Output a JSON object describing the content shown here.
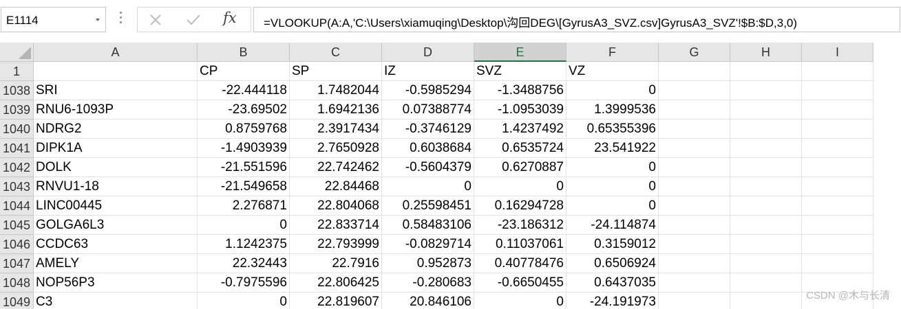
{
  "name_box": {
    "value": "E1114"
  },
  "formula_bar": {
    "fx_label": "fx",
    "formula": "=VLOOKUP(A:A,'C:\\Users\\xiamuqing\\Desktop\\沟回DEG\\[GyrusA3_SVZ.csv]GyrusA3_SVZ'!$B:$D,3,0)"
  },
  "columns": [
    "A",
    "B",
    "C",
    "D",
    "E",
    "F",
    "G",
    "H",
    "I"
  ],
  "selected_column": "E",
  "rows": [
    {
      "num": "1",
      "cells": [
        "",
        "CP",
        "SP",
        "IZ",
        "SVZ",
        "VZ"
      ]
    },
    {
      "num": "1038",
      "cells": [
        "SRI",
        "-22.444118",
        "1.7482044",
        "-0.5985294",
        "-1.3488756",
        "0"
      ]
    },
    {
      "num": "1039",
      "cells": [
        "RNU6-1093P",
        "-23.69502",
        "1.6942136",
        "0.07388774",
        "-1.0953039",
        "1.3999536"
      ]
    },
    {
      "num": "1040",
      "cells": [
        "NDRG2",
        "0.8759768",
        "2.3917434",
        "-0.3746129",
        "1.4237492",
        "0.65355396"
      ]
    },
    {
      "num": "1041",
      "cells": [
        "DIPK1A",
        "-1.4903939",
        "2.7650928",
        "0.6038684",
        "0.6535724",
        "23.541922"
      ]
    },
    {
      "num": "1042",
      "cells": [
        "DOLK",
        "-21.551596",
        "22.742462",
        "-0.5604379",
        "0.6270887",
        "0"
      ]
    },
    {
      "num": "1043",
      "cells": [
        "RNVU1-18",
        "-21.549658",
        "22.84468",
        "0",
        "0",
        "0"
      ]
    },
    {
      "num": "1044",
      "cells": [
        "LINC00445",
        "2.276871",
        "22.804068",
        "0.25598451",
        "0.16294728",
        "0"
      ]
    },
    {
      "num": "1045",
      "cells": [
        "GOLGA6L3",
        "0",
        "22.833714",
        "0.58483106",
        "-23.186312",
        "-24.114874"
      ]
    },
    {
      "num": "1046",
      "cells": [
        "CCDC63",
        "1.1242375",
        "22.793999",
        "-0.0829714",
        "0.11037061",
        "0.3159012"
      ]
    },
    {
      "num": "1047",
      "cells": [
        "AMELY",
        "22.32443",
        "22.7916",
        "0.952873",
        "0.40778476",
        "0.6506924"
      ]
    },
    {
      "num": "1048",
      "cells": [
        "NOP56P3",
        "-0.7975596",
        "22.806425",
        "-0.280683",
        "-0.6650455",
        "0.6437035"
      ]
    },
    {
      "num": "1049",
      "cells": [
        "C3",
        "0",
        "22.819607",
        "20.846106",
        "0",
        "-24.191973"
      ]
    }
  ],
  "watermark": "CSDN @木与长清"
}
